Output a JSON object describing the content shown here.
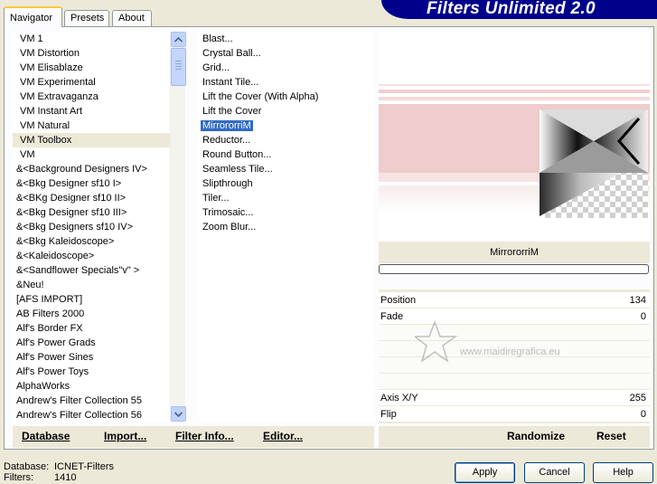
{
  "tabs": [
    {
      "label": "Navigator",
      "active": true
    },
    {
      "label": "Presets",
      "active": false
    },
    {
      "label": "About",
      "active": false
    }
  ],
  "banner": {
    "title": "Filters Unlimited 2.0",
    "color": "#00008b"
  },
  "categories": {
    "items": [
      "VM 1",
      "VM Distortion",
      "VM Elisablaze",
      "VM Experimental",
      "VM Extravaganza",
      "VM Instant Art",
      "VM Natural",
      "VM Toolbox",
      "VM",
      "&<Background Designers IV>",
      "&<Bkg Designer sf10 I>",
      "&<BKg Designer sf10 II>",
      "&<Bkg Designer sf10 III>",
      "&<Bkg Designers sf10 IV>",
      "&<Bkg Kaleidoscope>",
      "&<Kaleidoscope>",
      "&<Sandflower Specials\"v\" >",
      "&Neu!",
      "[AFS IMPORT]",
      "AB Filters 2000",
      "Alf's Border FX",
      "Alf's Power Grads",
      "Alf's Power Sines",
      "Alf's Power Toys",
      "AlphaWorks",
      "Andrew's Filter Collection 55",
      "Andrew's Filter Collection 56"
    ],
    "selected": "VM Toolbox"
  },
  "filters": {
    "items": [
      "Blast...",
      "Crystal Ball...",
      "Grid...",
      "Instant Tile...",
      "Lift the Cover (With Alpha)",
      "Lift the Cover",
      "MirrororriM",
      "Reductor...",
      "Round Button...",
      "Seamless Tile...",
      "Slipthrough",
      "Tiler...",
      "Trimosaic...",
      "Zoom Blur..."
    ],
    "selected": "MirrororriM"
  },
  "left_buttons": {
    "database": "Database",
    "import": "Import...",
    "filter_info": "Filter Info...",
    "editor": "Editor..."
  },
  "preview": {
    "filter_name": "MirrororriM"
  },
  "controls": {
    "rows": [
      {
        "label": "Position",
        "value": "134"
      },
      {
        "label": "Fade",
        "value": "0"
      },
      {
        "label": "Axis X/Y",
        "value": "255"
      },
      {
        "label": "Flip",
        "value": "0"
      }
    ],
    "watermark": "www.maidiregrafica.eu"
  },
  "right_buttons": {
    "randomize": "Randomize",
    "reset": "Reset"
  },
  "footer": {
    "database_label": "Database:",
    "database_value": "ICNET-Filters",
    "filters_label": "Filters:",
    "filters_value": "1410"
  },
  "dialog_buttons": {
    "apply": "Apply",
    "cancel": "Cancel",
    "help": "Help"
  },
  "colors": {
    "selection": "#316ac5",
    "accent_tab": "#ffc83c",
    "preview_pink": "#f2d0d1"
  }
}
